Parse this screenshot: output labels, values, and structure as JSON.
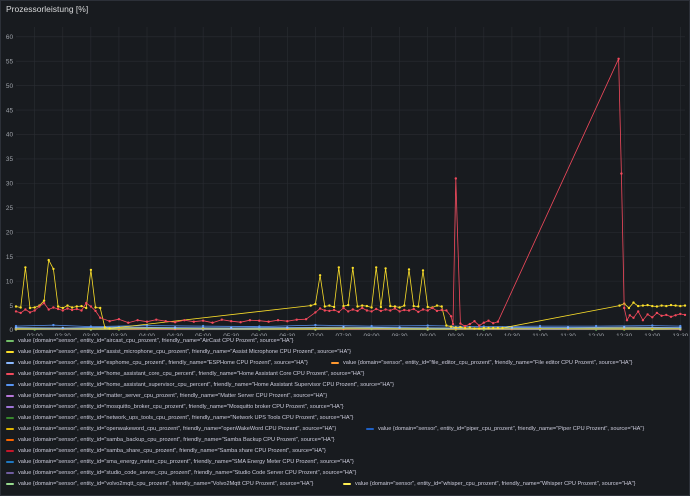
{
  "panel": {
    "title": "Prozessorleistung [%]"
  },
  "chart_data": {
    "type": "line",
    "title": "Prozessorleistung [%]",
    "xlabel": "",
    "ylabel": "",
    "ylim": [
      0,
      62
    ],
    "yticks": [
      0,
      5,
      10,
      15,
      20,
      25,
      30,
      35,
      40,
      45,
      50,
      55,
      60
    ],
    "xticks": [
      "02:00",
      "02:30",
      "03:00",
      "03:30",
      "04:00",
      "04:30",
      "05:00",
      "05:30",
      "06:00",
      "06:30",
      "07:00",
      "07:30",
      "08:00",
      "08:30",
      "09:00",
      "09:30",
      "10:00",
      "10:30",
      "11:00",
      "11:30",
      "12:00",
      "12:30",
      "13:00",
      "13:30"
    ],
    "xlim": [
      "01:40",
      "13:35"
    ],
    "grid": true,
    "series": [
      {
        "name": "value {domain=\"sensor\", entity_id=\"aircast_cpu_prozent\", friendly_name=\"AirCast CPU Prozent\", source=\"HA\"}",
        "color": "#73bf69",
        "x": [
          "01:40",
          "02:00",
          "02:30",
          "03:00",
          "03:30",
          "04:00",
          "05:00",
          "06:00",
          "07:00",
          "08:00",
          "09:00",
          "09:30",
          "10:00",
          "11:00",
          "12:00",
          "12:30",
          "13:00",
          "13:30"
        ],
        "y": [
          0.1,
          0.1,
          0.2,
          0.1,
          0.1,
          0.2,
          0.1,
          0.1,
          0.1,
          0.2,
          0.1,
          0.1,
          0.1,
          0.1,
          0.1,
          0.1,
          0.1,
          0.2
        ]
      },
      {
        "name": "value {domain=\"sensor\", entity_id=\"assist_microphone_cpu_prozent\", friendly_name=\"Assist Microphone CPU Prozent\", source=\"HA\"}",
        "color": "#fade2a",
        "x": [
          "01:40",
          "01:45",
          "01:50",
          "01:55",
          "02:00",
          "02:05",
          "02:10",
          "02:15",
          "02:20",
          "02:25",
          "02:30",
          "02:35",
          "02:40",
          "02:45",
          "02:50",
          "02:55",
          "03:00",
          "03:05",
          "03:10",
          "03:15",
          "03:20",
          "06:55",
          "07:00",
          "07:05",
          "07:10",
          "07:15",
          "07:20",
          "07:25",
          "07:30",
          "07:35",
          "07:40",
          "07:45",
          "07:50",
          "07:55",
          "08:00",
          "08:05",
          "08:10",
          "08:15",
          "08:20",
          "08:25",
          "08:30",
          "08:35",
          "08:40",
          "08:45",
          "08:50",
          "08:55",
          "09:00",
          "09:05",
          "09:10",
          "09:15",
          "09:20",
          "09:25",
          "09:30",
          "09:35",
          "09:40",
          "09:45",
          "09:50",
          "09:55",
          "10:00",
          "10:05",
          "10:10",
          "10:15",
          "10:20",
          "12:25",
          "12:30",
          "12:35",
          "12:40",
          "12:45",
          "12:50",
          "12:55",
          "13:00",
          "13:05",
          "13:10",
          "13:15",
          "13:20",
          "13:25",
          "13:30",
          "13:35"
        ],
        "y": [
          4.8,
          4.6,
          12.8,
          4.5,
          4.6,
          5.0,
          6.0,
          14.3,
          12.5,
          4.8,
          4.5,
          5.0,
          4.6,
          4.8,
          4.9,
          4.5,
          12.3,
          4.6,
          4.5,
          0.5,
          0.3,
          5.0,
          5.3,
          11.2,
          4.8,
          5.0,
          4.7,
          12.8,
          4.9,
          5.1,
          12.7,
          4.8,
          5.0,
          4.9,
          4.6,
          12.8,
          4.7,
          12.6,
          4.9,
          4.8,
          4.6,
          5.0,
          12.4,
          4.9,
          4.8,
          12.2,
          4.7,
          4.6,
          5.0,
          4.8,
          0.9,
          0.7,
          0.5,
          0.6,
          0.4,
          0.5,
          0.3,
          0.3,
          0.4,
          0.4,
          0.4,
          0.4,
          0.4,
          5.0,
          5.4,
          4.5,
          5.6,
          4.9,
          5.0,
          5.1,
          4.9,
          4.8,
          5.0,
          4.9,
          5.1,
          5.0,
          4.9,
          5.0
        ]
      },
      {
        "name": "value {domain=\"sensor\", entity_id=\"esphome_cpu_prozent\", friendly_name=\"ESPHome CPU Prozent\", source=\"HA\"}",
        "color": "#8ab8ff",
        "x": [
          "01:40",
          "02:30",
          "03:30",
          "04:30",
          "05:30",
          "06:30",
          "07:30",
          "08:30",
          "09:30",
          "10:30",
          "11:30",
          "12:30",
          "13:30"
        ],
        "y": [
          0.5,
          0.4,
          0.6,
          0.5,
          0.4,
          0.5,
          0.6,
          0.5,
          0.4,
          0.5,
          0.5,
          0.6,
          0.5
        ]
      },
      {
        "name": "value {domain=\"sensor\", entity_id=\"file_editor_cpu_prozent\", friendly_name=\"File editor CPU Prozent\", source=\"HA\"}",
        "color": "#ff9830",
        "x": [
          "01:40",
          "02:30",
          "03:30",
          "04:30",
          "05:30",
          "06:30",
          "07:30",
          "08:30",
          "09:30",
          "10:30",
          "11:30",
          "12:30",
          "13:30"
        ],
        "y": [
          0.2,
          0.3,
          0.2,
          0.2,
          0.3,
          0.2,
          0.2,
          0.3,
          0.2,
          0.2,
          0.2,
          0.2,
          0.3
        ]
      },
      {
        "name": "value {domain=\"sensor\", entity_id=\"home_assistant_core_cpu_percent\", friendly_name=\"Home Assistant Core CPU Prozent\", source=\"HA\"}",
        "color": "#f2495c",
        "x": [
          "01:40",
          "01:45",
          "01:50",
          "01:55",
          "02:00",
          "02:05",
          "02:10",
          "02:15",
          "02:20",
          "02:25",
          "02:30",
          "02:35",
          "02:40",
          "02:45",
          "02:50",
          "02:55",
          "03:00",
          "03:05",
          "03:10",
          "03:20",
          "03:30",
          "03:40",
          "03:50",
          "04:00",
          "04:10",
          "04:20",
          "04:30",
          "04:40",
          "04:50",
          "05:00",
          "05:10",
          "05:20",
          "05:30",
          "05:40",
          "05:50",
          "06:00",
          "06:10",
          "06:20",
          "06:30",
          "06:40",
          "06:50",
          "07:00",
          "07:05",
          "07:10",
          "07:15",
          "07:20",
          "07:25",
          "07:30",
          "07:35",
          "07:40",
          "07:45",
          "07:50",
          "07:55",
          "08:00",
          "08:05",
          "08:10",
          "08:15",
          "08:20",
          "08:25",
          "08:30",
          "08:35",
          "08:40",
          "08:45",
          "08:50",
          "08:55",
          "09:00",
          "09:05",
          "09:10",
          "09:15",
          "09:20",
          "09:25",
          "09:27",
          "09:30",
          "09:35",
          "09:40",
          "09:45",
          "09:50",
          "09:55",
          "10:00",
          "10:05",
          "10:10",
          "10:15",
          "12:24",
          "12:27",
          "12:30",
          "12:33",
          "12:36",
          "12:40",
          "12:45",
          "12:50",
          "12:55",
          "13:00",
          "13:05",
          "13:10",
          "13:15",
          "13:20",
          "13:25",
          "13:30",
          "13:35"
        ],
        "y": [
          3.8,
          3.5,
          4.2,
          3.6,
          4.0,
          4.8,
          5.5,
          4.2,
          4.6,
          4.3,
          4.0,
          4.4,
          4.1,
          4.3,
          4.0,
          5.5,
          4.8,
          3.9,
          2.5,
          1.8,
          2.2,
          1.5,
          2.0,
          1.7,
          2.1,
          1.8,
          1.6,
          2.0,
          1.7,
          1.9,
          1.5,
          2.1,
          1.8,
          1.6,
          2.0,
          1.9,
          1.7,
          2.0,
          1.8,
          2.1,
          2.2,
          3.6,
          4.4,
          4.0,
          3.9,
          4.1,
          3.7,
          4.5,
          3.8,
          4.2,
          3.9,
          4.5,
          4.0,
          3.8,
          4.3,
          3.9,
          4.2,
          4.0,
          4.4,
          3.8,
          4.1,
          4.0,
          4.3,
          3.7,
          4.2,
          4.0,
          4.5,
          3.9,
          4.1,
          4.0,
          2.8,
          1.2,
          31.0,
          1.3,
          0.8,
          1.2,
          1.8,
          0.9,
          1.5,
          1.9,
          1.4,
          1.7,
          55.5,
          32.0,
          4.5,
          2.0,
          3.0,
          2.5,
          3.8,
          2.0,
          3.2,
          2.6,
          3.5,
          2.9,
          3.1,
          2.7,
          3.0,
          3.3,
          3.1
        ]
      },
      {
        "name": "value {domain=\"sensor\", entity_id=\"home_assistant_supervisor_cpu_percent\", friendly_name=\"Home Assistant Supervisor CPU Prozent\", source=\"HA\"}",
        "color": "#5794f2",
        "x": [
          "01:40",
          "02:20",
          "03:00",
          "04:00",
          "05:00",
          "06:00",
          "07:00",
          "08:00",
          "09:00",
          "10:00",
          "11:00",
          "12:00",
          "13:00",
          "13:30"
        ],
        "y": [
          0.8,
          1.0,
          0.7,
          0.9,
          0.8,
          0.7,
          1.0,
          0.8,
          0.9,
          0.7,
          0.8,
          0.8,
          0.9,
          0.8
        ]
      },
      {
        "name": "value {domain=\"sensor\", entity_id=\"matter_server_cpu_prozent\", friendly_name=\"Matter Server CPU Prozent\", source=\"HA\"}",
        "color": "#b877d9",
        "x": [
          "01:40",
          "03:00",
          "05:00",
          "07:00",
          "09:00",
          "11:00",
          "13:00",
          "13:30"
        ],
        "y": [
          0.3,
          0.3,
          0.2,
          0.3,
          0.3,
          0.2,
          0.3,
          0.3
        ]
      },
      {
        "name": "value {domain=\"sensor\", entity_id=\"mosquitto_broker_cpu_prozent\", friendly_name=\"Mosquitto broker CPU Prozent\", source=\"HA\"}",
        "color": "#9e74d6",
        "x": [
          "01:40",
          "03:00",
          "05:00",
          "07:00",
          "09:00",
          "11:00",
          "13:00",
          "13:30"
        ],
        "y": [
          0.2,
          0.2,
          0.2,
          0.2,
          0.2,
          0.2,
          0.2,
          0.2
        ]
      },
      {
        "name": "value {domain=\"sensor\", entity_id=\"network_ups_tools_cpu_prozent\", friendly_name=\"Network UPS Tools CPU Prozent\", source=\"HA\"}",
        "color": "#37872d",
        "x": [
          "01:40",
          "03:00",
          "05:00",
          "07:00",
          "09:00",
          "11:00",
          "13:00",
          "13:30"
        ],
        "y": [
          0.1,
          0.1,
          0.1,
          0.1,
          0.1,
          0.1,
          0.1,
          0.1
        ]
      },
      {
        "name": "value {domain=\"sensor\", entity_id=\"openwakeword_cpu_prozent\", friendly_name=\"openWakeWord CPU Prozent\", source=\"HA\"}",
        "color": "#e0b400",
        "x": [
          "01:40",
          "03:00",
          "05:00",
          "07:00",
          "09:00",
          "11:00",
          "13:00",
          "13:30"
        ],
        "y": [
          0.4,
          0.4,
          0.4,
          0.4,
          0.4,
          0.4,
          0.4,
          0.4
        ]
      },
      {
        "name": "value {domain=\"sensor\", entity_id=\"piper_cpu_prozent\", friendly_name=\"Piper CPU Prozent\", source=\"HA\"}",
        "color": "#1f60c4",
        "x": [
          "01:40",
          "03:00",
          "05:00",
          "07:00",
          "09:00",
          "11:00",
          "13:00",
          "13:30"
        ],
        "y": [
          0.1,
          0.1,
          0.1,
          0.1,
          0.1,
          0.1,
          0.1,
          0.1
        ]
      },
      {
        "name": "value {domain=\"sensor\", entity_id=\"samba_backup_cpu_prozent\", friendly_name=\"Samba Backup CPU Prozent\", source=\"HA\"}",
        "color": "#fa6400",
        "x": [
          "01:40",
          "03:00",
          "05:00",
          "07:00",
          "09:00",
          "11:00",
          "13:00",
          "13:30"
        ],
        "y": [
          0.1,
          0.1,
          0.1,
          0.1,
          0.1,
          0.1,
          0.1,
          0.1
        ]
      },
      {
        "name": "value {domain=\"sensor\", entity_id=\"samba_share_cpu_prozent\", friendly_name=\"Samba share CPU Prozent\", source=\"HA\"}",
        "color": "#c4162a",
        "x": [
          "01:40",
          "03:00",
          "05:00",
          "07:00",
          "09:00",
          "11:00",
          "13:00",
          "13:30"
        ],
        "y": [
          0.1,
          0.1,
          0.1,
          0.1,
          0.1,
          0.1,
          0.1,
          0.1
        ]
      },
      {
        "name": "value {domain=\"sensor\", entity_id=\"sma_energy_meter_cpu_prozent\", friendly_name=\"SMA Energy Meter CPU Prozent\", source=\"HA\"}",
        "color": "#1f78c1",
        "x": [
          "01:40",
          "03:00",
          "05:00",
          "07:00",
          "09:00",
          "11:00",
          "13:00",
          "13:30"
        ],
        "y": [
          0.2,
          0.2,
          0.2,
          0.2,
          0.2,
          0.2,
          0.2,
          0.2
        ]
      },
      {
        "name": "value {domain=\"sensor\", entity_id=\"studio_code_server_cpu_prozent\", friendly_name=\"Studio Code Server CPU Prozent\", source=\"HA\"}",
        "color": "#705da0",
        "x": [
          "01:40",
          "03:00",
          "05:00",
          "07:00",
          "09:00",
          "11:00",
          "13:00",
          "13:30"
        ],
        "y": [
          0.1,
          0.1,
          0.1,
          0.1,
          0.1,
          0.1,
          0.1,
          0.1
        ]
      },
      {
        "name": "value {domain=\"sensor\", entity_id=\"volvo2mqtt_cpu_prozent\", friendly_name=\"Volvo2Mqtt CPU Prozent\", source=\"HA\"}",
        "color": "#96d98d",
        "x": [
          "01:40",
          "03:00",
          "05:00",
          "07:00",
          "09:00",
          "11:00",
          "13:00",
          "13:30"
        ],
        "y": [
          0.3,
          0.3,
          0.3,
          0.3,
          0.3,
          0.3,
          0.3,
          0.3
        ]
      },
      {
        "name": "value {domain=\"sensor\", entity_id=\"whisper_cpu_prozent\", friendly_name=\"Whisper CPU Prozent\", source=\"HA\"}",
        "color": "#ffee52",
        "x": [
          "01:40",
          "03:00",
          "05:00",
          "07:00",
          "09:00",
          "11:00",
          "13:00",
          "13:30"
        ],
        "y": [
          0.2,
          0.2,
          0.2,
          0.2,
          0.2,
          0.2,
          0.2,
          0.2
        ]
      }
    ]
  },
  "legend": [
    {
      "text": "value {domain=\"sensor\", entity_id=\"aircast_cpu_prozent\", friendly_name=\"AirCast CPU Prozent\", source=\"HA\"}",
      "color": "#73bf69"
    },
    {
      "text": "value {domain=\"sensor\", entity_id=\"assist_microphone_cpu_prozent\", friendly_name=\"Assist Microphone CPU Prozent\", source=\"HA\"}",
      "color": "#fade2a"
    },
    {
      "text": "value {domain=\"sensor\", entity_id=\"esphome_cpu_prozent\", friendly_name=\"ESPHome CPU Prozent\", source=\"HA\"}",
      "color": "#8ab8ff"
    },
    {
      "text": "value {domain=\"sensor\", entity_id=\"file_editor_cpu_prozent\", friendly_name=\"File editor CPU Prozent\", source=\"HA\"}",
      "color": "#ff9830"
    },
    {
      "text": "value {domain=\"sensor\", entity_id=\"home_assistant_core_cpu_percent\", friendly_name=\"Home Assistant Core CPU Prozent\", source=\"HA\"}",
      "color": "#f2495c"
    },
    {
      "text": "value {domain=\"sensor\", entity_id=\"home_assistant_supervisor_cpu_percent\", friendly_name=\"Home Assistant Supervisor CPU Prozent\", source=\"HA\"}",
      "color": "#5794f2"
    },
    {
      "text": "value {domain=\"sensor\", entity_id=\"matter_server_cpu_prozent\", friendly_name=\"Matter Server CPU Prozent\", source=\"HA\"}",
      "color": "#b877d9"
    },
    {
      "text": "value {domain=\"sensor\", entity_id=\"mosquitto_broker_cpu_prozent\", friendly_name=\"Mosquitto broker CPU Prozent\", source=\"HA\"}",
      "color": "#9e74d6"
    },
    {
      "text": "value {domain=\"sensor\", entity_id=\"network_ups_tools_cpu_prozent\", friendly_name=\"Network UPS Tools CPU Prozent\", source=\"HA\"}",
      "color": "#37872d"
    },
    {
      "text": "value {domain=\"sensor\", entity_id=\"openwakeword_cpu_prozent\", friendly_name=\"openWakeWord CPU Prozent\", source=\"HA\"}",
      "color": "#e0b400"
    },
    {
      "text": "value {domain=\"sensor\", entity_id=\"piper_cpu_prozent\", friendly_name=\"Piper CPU Prozent\", source=\"HA\"}",
      "color": "#1f60c4"
    },
    {
      "text": "value {domain=\"sensor\", entity_id=\"samba_backup_cpu_prozent\", friendly_name=\"Samba Backup CPU Prozent\", source=\"HA\"}",
      "color": "#fa6400"
    },
    {
      "text": "value {domain=\"sensor\", entity_id=\"samba_share_cpu_prozent\", friendly_name=\"Samba share CPU Prozent\", source=\"HA\"}",
      "color": "#c4162a"
    },
    {
      "text": "value {domain=\"sensor\", entity_id=\"sma_energy_meter_cpu_prozent\", friendly_name=\"SMA Energy Meter CPU Prozent\", source=\"HA\"}",
      "color": "#1f78c1"
    },
    {
      "text": "value {domain=\"sensor\", entity_id=\"studio_code_server_cpu_prozent\", friendly_name=\"Studio Code Server CPU Prozent\", source=\"HA\"}",
      "color": "#705da0"
    },
    {
      "text": "value {domain=\"sensor\", entity_id=\"volvo2mqtt_cpu_prozent\", friendly_name=\"Volvo2Mqtt CPU Prozent\", source=\"HA\"}",
      "color": "#96d98d"
    },
    {
      "text": "value {domain=\"sensor\", entity_id=\"whisper_cpu_prozent\", friendly_name=\"Whisper CPU Prozent\", source=\"HA\"}",
      "color": "#ffee52"
    }
  ]
}
